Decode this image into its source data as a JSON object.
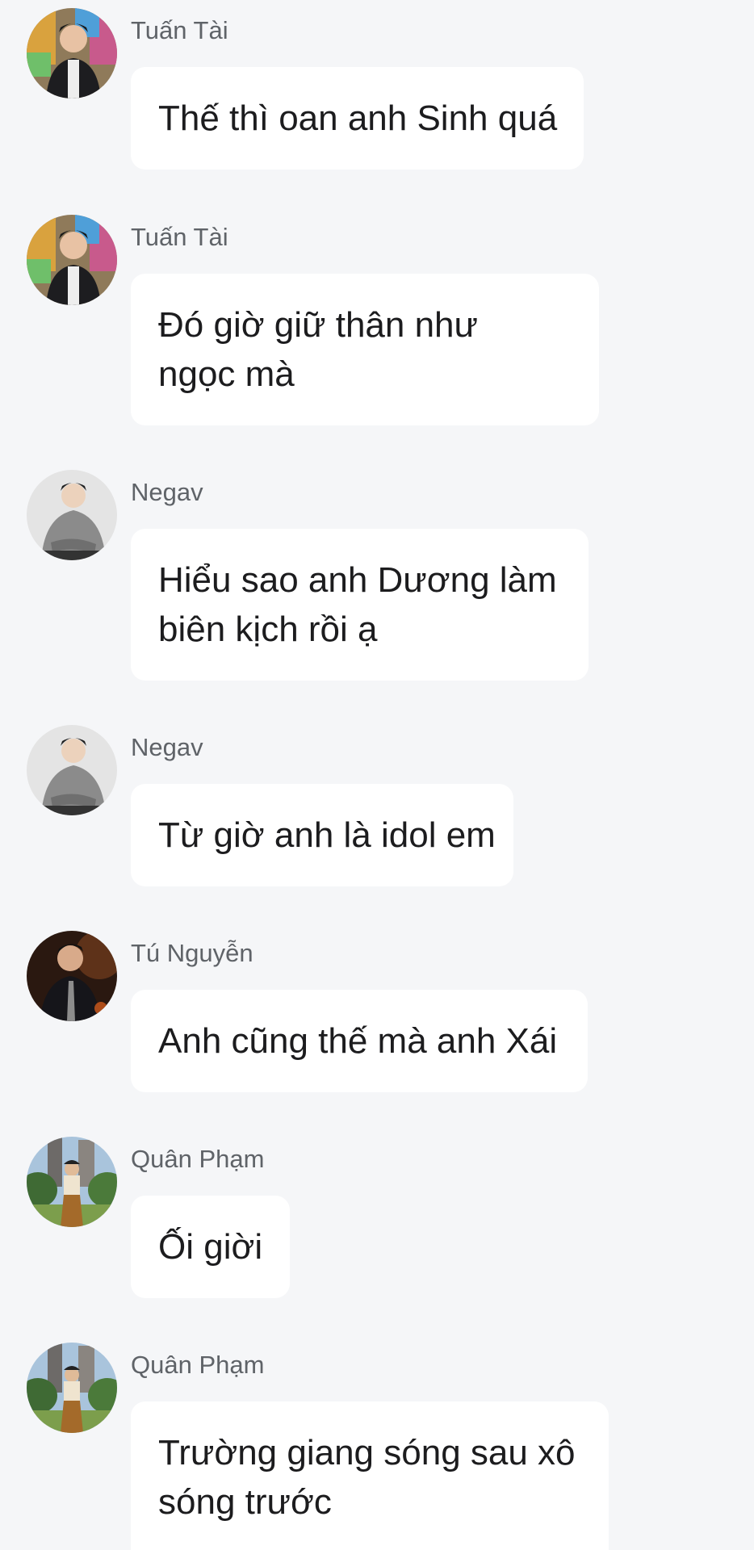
{
  "messages": [
    {
      "sender": "Tuấn Tài",
      "avatar": "avatar-tuan-tai",
      "lines": [
        "Thế thì oan anh Sinh quá"
      ]
    },
    {
      "sender": "Tuấn Tài",
      "avatar": "avatar-tuan-tai",
      "lines": [
        "Đó giờ giữ thân như",
        "ngọc mà"
      ]
    },
    {
      "sender": "Negav",
      "avatar": "avatar-negav",
      "lines": [
        "Hiểu sao anh Dương làm",
        "biên kịch rồi ạ"
      ]
    },
    {
      "sender": "Negav",
      "avatar": "avatar-negav",
      "lines": [
        "Từ giờ anh là idol em"
      ]
    },
    {
      "sender": "Tú Nguyễn",
      "avatar": "avatar-tu-nguyen",
      "lines": [
        "Anh cũng thế mà anh Xái"
      ]
    },
    {
      "sender": "Quân Phạm",
      "avatar": "avatar-quan-pham",
      "lines": [
        "Ối giời"
      ]
    },
    {
      "sender": "Quân Phạm",
      "avatar": "avatar-quan-pham",
      "lines": [
        "Trường giang sóng sau xô",
        "sóng trước"
      ]
    }
  ]
}
